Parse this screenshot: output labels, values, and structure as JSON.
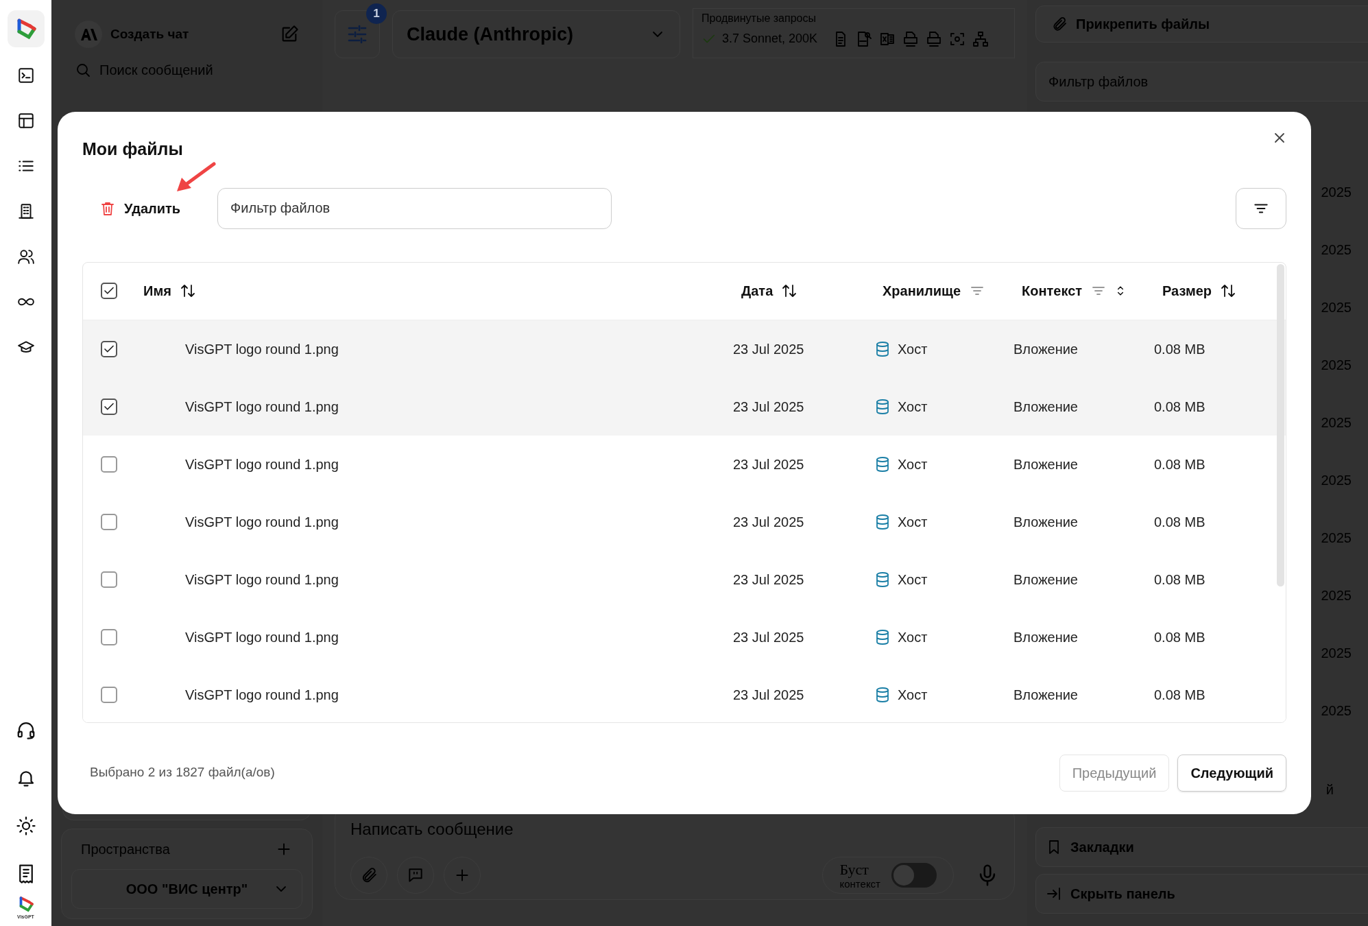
{
  "sidebar": {
    "logo_caption": "VisGPT"
  },
  "chat_panel": {
    "new_chat": "Создать чат",
    "search_placeholder": "Поиск сообщений",
    "spaces": {
      "title": "Пространства",
      "current": "ООО \"ВИС центр\""
    }
  },
  "toolbar": {
    "settings_badge": "1",
    "model": "Claude (Anthropic)",
    "advanced": {
      "label": "Продвинутые запросы",
      "value": "3.7 Sonnet, 200K"
    }
  },
  "composer": {
    "placeholder": "Написать сообщение",
    "boost": {
      "label": "Буст",
      "sublabel": "контекст",
      "on": false
    }
  },
  "files_panel": {
    "attach": "Прикрепить файлы",
    "filter_placeholder": "Фильтр файлов",
    "date_fragments": [
      "2025",
      "2025",
      "2025",
      "2025",
      "2025",
      "2025",
      "2025",
      "2025",
      "2025",
      "2025"
    ],
    "button_fragment": "й",
    "bookmarks": "Закладки",
    "hide_panel": "Скрыть панель"
  },
  "dialog": {
    "title": "Мои файлы",
    "delete": "Удалить",
    "filter_placeholder": "Фильтр файлов",
    "columns": [
      {
        "label": "Имя",
        "kind": "sort"
      },
      {
        "label": "Дата",
        "kind": "sort"
      },
      {
        "label": "Хранилище",
        "kind": "filter"
      },
      {
        "label": "Контекст",
        "kind": "filter-sort"
      },
      {
        "label": "Размер",
        "kind": "sort"
      }
    ],
    "select_all": {
      "checked": true
    },
    "rows": [
      {
        "name": "VisGPT logo round 1.png",
        "date": "23 Jul 2025",
        "storage": "Хост",
        "context": "Вложение",
        "size": "0.08 MB",
        "selected": true
      },
      {
        "name": "VisGPT logo round 1.png",
        "date": "23 Jul 2025",
        "storage": "Хост",
        "context": "Вложение",
        "size": "0.08 MB",
        "selected": true
      },
      {
        "name": "VisGPT logo round 1.png",
        "date": "23 Jul 2025",
        "storage": "Хост",
        "context": "Вложение",
        "size": "0.08 MB",
        "selected": false
      },
      {
        "name": "VisGPT logo round 1.png",
        "date": "23 Jul 2025",
        "storage": "Хост",
        "context": "Вложение",
        "size": "0.08 MB",
        "selected": false
      },
      {
        "name": "VisGPT logo round 1.png",
        "date": "23 Jul 2025",
        "storage": "Хост",
        "context": "Вложение",
        "size": "0.08 MB",
        "selected": false
      },
      {
        "name": "VisGPT logo round 1.png",
        "date": "23 Jul 2025",
        "storage": "Хост",
        "context": "Вложение",
        "size": "0.08 MB",
        "selected": false
      },
      {
        "name": "VisGPT logo round 1.png",
        "date": "23 Jul 2025",
        "storage": "Хост",
        "context": "Вложение",
        "size": "0.08 MB",
        "selected": false
      }
    ],
    "summary": "Выбрано 2 из 1827 файл(а/ов)",
    "prev": {
      "label": "Предыдущий",
      "disabled": true
    },
    "next": {
      "label": "Следующий",
      "disabled": false
    }
  }
}
